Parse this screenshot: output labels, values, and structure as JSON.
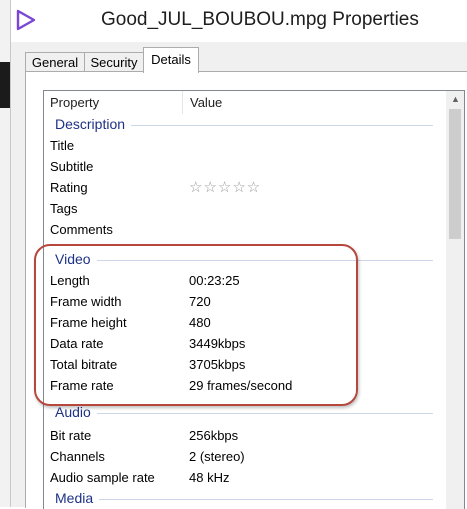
{
  "window": {
    "title": "Good_JUL_BOUBOU.mpg Properties"
  },
  "tabs": [
    {
      "label": "General"
    },
    {
      "label": "Security"
    },
    {
      "label": "Details"
    }
  ],
  "columns": {
    "property": "Property",
    "value": "Value"
  },
  "groups": {
    "description": "Description",
    "video": "Video",
    "audio": "Audio",
    "media": "Media"
  },
  "description_rows": [
    {
      "k": "Title",
      "v": ""
    },
    {
      "k": "Subtitle",
      "v": ""
    },
    {
      "k": "Rating",
      "v": "☆☆☆☆☆"
    },
    {
      "k": "Tags",
      "v": ""
    },
    {
      "k": "Comments",
      "v": ""
    }
  ],
  "video_rows": [
    {
      "k": "Length",
      "v": "00:23:25"
    },
    {
      "k": "Frame width",
      "v": "720"
    },
    {
      "k": "Frame height",
      "v": "480"
    },
    {
      "k": "Data rate",
      "v": "3449kbps"
    },
    {
      "k": "Total bitrate",
      "v": "3705kbps"
    },
    {
      "k": "Frame rate",
      "v": "29 frames/second"
    }
  ],
  "audio_rows": [
    {
      "k": "Bit rate",
      "v": "256kbps"
    },
    {
      "k": "Channels",
      "v": "2 (stereo)"
    },
    {
      "k": "Audio sample rate",
      "v": "48 kHz"
    }
  ],
  "rating_value": 0,
  "colors": {
    "accent": "#1e3287",
    "highlight": "#b5473c",
    "icon": "#7b46d6"
  }
}
